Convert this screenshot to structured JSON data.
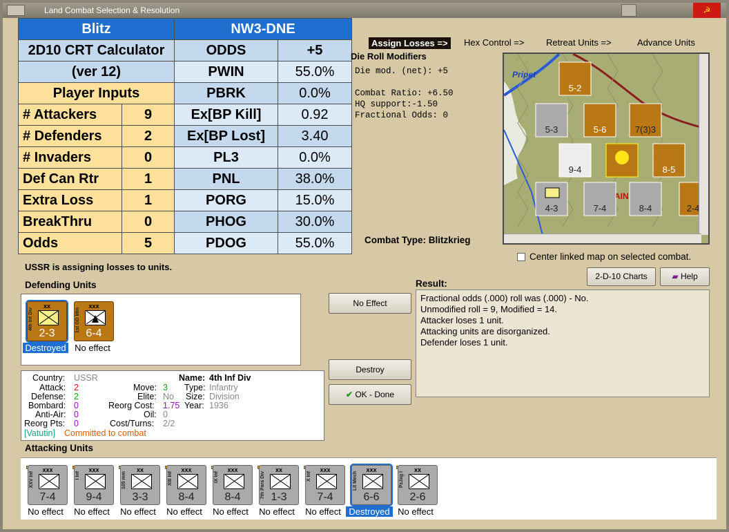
{
  "window": {
    "title": "Land Combat Selection & Resolution"
  },
  "crt": {
    "header_left": "Blitz",
    "header_right": "NW3-DNE",
    "calc_title_line1": "2D10 CRT Calculator",
    "calc_title_line2": "(ver 12)",
    "player_inputs": "Player Inputs",
    "inputs": [
      {
        "label": "# Attackers",
        "value": "9"
      },
      {
        "label": "# Defenders",
        "value": "2"
      },
      {
        "label": "# Invaders",
        "value": "0"
      },
      {
        "label": "Def Can Rtr",
        "value": "1"
      },
      {
        "label": "Extra Loss",
        "value": "1"
      },
      {
        "label": "BreakThru",
        "value": "0"
      },
      {
        "label": "Odds",
        "value": "5"
      }
    ],
    "outputs": [
      {
        "label": "ODDS",
        "value": "+5"
      },
      {
        "label": "PWIN",
        "value": "55.0%"
      },
      {
        "label": "PBRK",
        "value": "0.0%"
      },
      {
        "label": "Ex[BP Kill]",
        "value": "0.92"
      },
      {
        "label": "Ex[BP Lost]",
        "value": "3.40"
      },
      {
        "label": "PL3",
        "value": "0.0%"
      },
      {
        "label": "PNL",
        "value": "38.0%"
      },
      {
        "label": "PORG",
        "value": "15.0%"
      },
      {
        "label": "PHOG",
        "value": "30.0%"
      },
      {
        "label": "PDOG",
        "value": "55.0%"
      }
    ]
  },
  "menu": {
    "assign_losses": "Assign Losses =>",
    "hex_control": "Hex Control =>",
    "retreat_units": "Retreat Units =>",
    "advance_units": "Advance Units"
  },
  "die_roll": {
    "header": "Die Roll Modifiers",
    "net": "Die mod. (net): +5",
    "combat_ratio": "Combat Ratio: +6.50",
    "hq_support": "HQ support:-1.50",
    "fractional": "Fractional Odds: 0"
  },
  "combat_type": "Combat Type:  Blitzkrieg",
  "map": {
    "label_pripet": "Pripet",
    "label_ain": "AIN"
  },
  "center_linked": "Center linked map on selected combat.",
  "buttons": {
    "charts": "2-D-10 Charts",
    "help": "Help",
    "no_effect": "No Effect",
    "destroy": "Destroy",
    "ok_done": "OK - Done"
  },
  "status": "USSR is assigning losses to units.",
  "defending_header": "Defending Units",
  "attacking_header": "Attacking Units",
  "result": {
    "header": "Result:",
    "lines": [
      "Fractional odds (.000) roll was (.000)  -  No.",
      "Unmodified roll = 9, Modified = 14.",
      "Attacker loses 1 unit.",
      "Attacking units are disorganized.",
      "Defender loses 1 unit."
    ]
  },
  "defenders": [
    {
      "size": "xx",
      "name": "4th Inf Div",
      "str": "2-3",
      "status": "Destroyed",
      "selected": true
    },
    {
      "size": "xxx",
      "name": "1st GD Mtn",
      "str": "6-4",
      "status": "No effect",
      "selected": false
    }
  ],
  "info": {
    "country_k": "Country:",
    "country_v": "USSR",
    "attack_k": "Attack:",
    "attack_v": "2",
    "defense_k": "Defense:",
    "defense_v": "2",
    "bombard_k": "Bombard:",
    "bombard_v": "0",
    "antiair_k": "Anti-Air:",
    "antiair_v": "0",
    "reorg_k": "Reorg Pts:",
    "reorg_v": "0",
    "move_k": "Move:",
    "move_v": "3",
    "elite_k": "Elite:",
    "elite_v": "No",
    "reorgcost_k": "Reorg Cost:",
    "reorgcost_v": "1.75",
    "oil_k": "Oil:",
    "oil_v": "0",
    "cost_k": "Cost/Turns:",
    "cost_v": "2/2",
    "name_k": "Name:",
    "name_v": "4th Inf Div",
    "type_k": "Type:",
    "type_v": "Infantry",
    "size_k": "Size:",
    "size_v": "Division",
    "year_k": "Year:",
    "year_v": "1936",
    "commander": "[Vatutin]",
    "committed": "Committed to combat"
  },
  "attackers": [
    {
      "size": "xxx",
      "name": "XXV Inf",
      "str": "7-4",
      "status": "No effect"
    },
    {
      "size": "xxx",
      "name": "I Inf",
      "str": "9-4",
      "status": "No effect"
    },
    {
      "size": "xx",
      "name": "105 mm",
      "str": "3-3",
      "status": "No effect"
    },
    {
      "size": "xxx",
      "name": "XIII Inf",
      "str": "8-4",
      "status": "No effect"
    },
    {
      "size": "xxx",
      "name": "IX Inf",
      "str": "8-4",
      "status": "No effect"
    },
    {
      "size": "xx",
      "name": "7th Para Div",
      "str": "1-3",
      "status": "No effect"
    },
    {
      "size": "xxx",
      "name": "X Inf",
      "str": "7-4",
      "status": "No effect"
    },
    {
      "size": "xxx",
      "name": "LII Mech",
      "str": "6-6",
      "status": "Destroyed"
    },
    {
      "size": "xx",
      "name": "PzJag I",
      "str": "2-6",
      "status": "No effect"
    }
  ],
  "colors": {
    "header_blue": "#1e6fd0",
    "input_yellow": "#fde09a",
    "selected": "#1e6fd0"
  }
}
